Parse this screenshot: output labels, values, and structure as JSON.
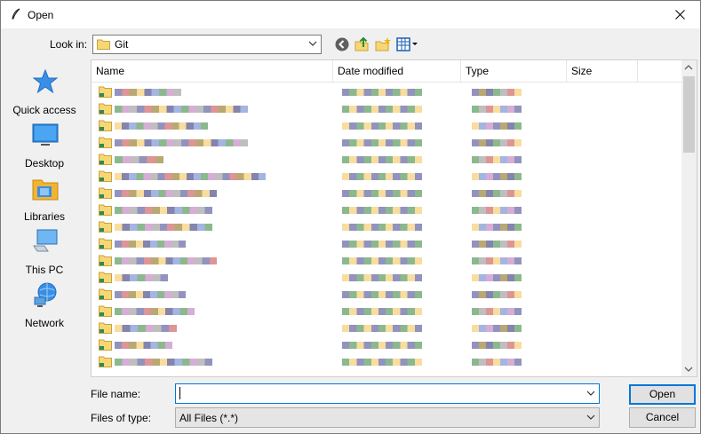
{
  "window": {
    "title": "Open"
  },
  "lookin": {
    "label": "Look in:",
    "value": "Git"
  },
  "places": [
    {
      "label": "Quick access"
    },
    {
      "label": "Desktop"
    },
    {
      "label": "Libraries"
    },
    {
      "label": "This PC"
    },
    {
      "label": "Network"
    }
  ],
  "columns": {
    "name": "Name",
    "date": "Date modified",
    "type": "Type",
    "size": "Size"
  },
  "filename": {
    "label": "File name:",
    "value": ""
  },
  "filetype": {
    "label": "Files of type:",
    "value": "All Files (*.*)"
  },
  "buttons": {
    "open": "Open",
    "cancel": "Cancel"
  },
  "colors": {
    "accent": "#0078d7",
    "folder": "#f7d774"
  },
  "rows_blurred": 17
}
